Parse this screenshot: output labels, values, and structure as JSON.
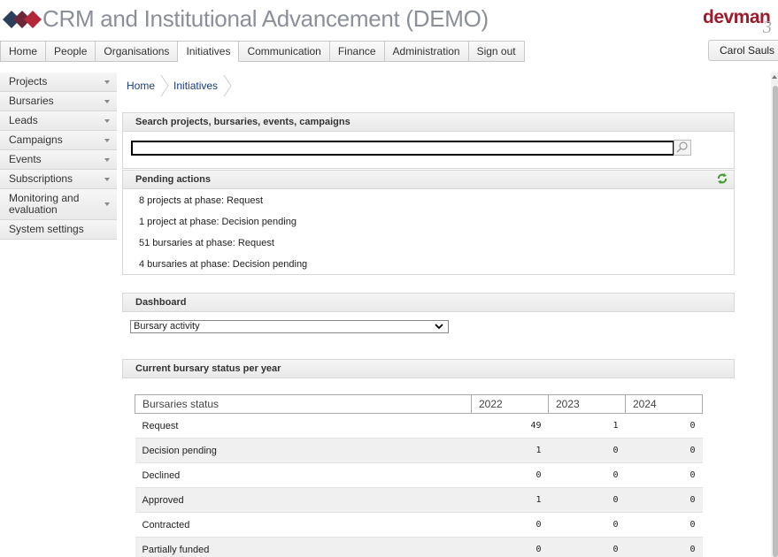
{
  "header": {
    "app_title": "CRM and Institutional Advancement (DEMO)",
    "brand": "devman",
    "brand_sup": "3"
  },
  "nav": {
    "tabs": [
      {
        "label": "Home"
      },
      {
        "label": "People"
      },
      {
        "label": "Organisations"
      },
      {
        "label": "Initiatives",
        "active": true
      },
      {
        "label": "Communication"
      },
      {
        "label": "Finance"
      },
      {
        "label": "Administration"
      },
      {
        "label": "Sign out"
      }
    ],
    "user": "Carol Sauls"
  },
  "sidebar": {
    "items": [
      {
        "label": "Projects",
        "has_menu": true
      },
      {
        "label": "Bursaries",
        "has_menu": true
      },
      {
        "label": "Leads",
        "has_menu": true
      },
      {
        "label": "Campaigns",
        "has_menu": true
      },
      {
        "label": "Events",
        "has_menu": true
      },
      {
        "label": "Subscriptions",
        "has_menu": true
      },
      {
        "label": "Monitoring and evaluation",
        "has_menu": true
      },
      {
        "label": "System settings",
        "has_menu": false
      }
    ]
  },
  "breadcrumb": [
    "Home",
    "Initiatives"
  ],
  "search": {
    "title": "Search projects, bursaries, events, campaigns",
    "value": ""
  },
  "pending": {
    "title": "Pending actions",
    "items": [
      "8 projects at phase: Request",
      "1 project at phase: Decision pending",
      "51 bursaries at phase: Request",
      "4 bursaries at phase: Decision pending"
    ]
  },
  "dashboard": {
    "title": "Dashboard",
    "selected": "Bursary activity"
  },
  "bursary_status": {
    "title": "Current bursary status per year",
    "header": [
      "Bursaries status",
      "2022",
      "2023",
      "2024"
    ],
    "rows": [
      [
        "Request",
        "49",
        "1",
        "0"
      ],
      [
        "Decision pending",
        "1",
        "0",
        "0"
      ],
      [
        "Declined",
        "0",
        "0",
        "0"
      ],
      [
        "Approved",
        "1",
        "0",
        "0"
      ],
      [
        "Contracted",
        "0",
        "0",
        "0"
      ],
      [
        "Partially funded",
        "0",
        "0",
        "0"
      ]
    ]
  },
  "colors": {
    "brand": "#9b1c2c",
    "logo_left": "#2b3e5c",
    "logo_right": "#b3273a",
    "refresh": "#3a9b2a",
    "link": "#1a3d7c"
  }
}
